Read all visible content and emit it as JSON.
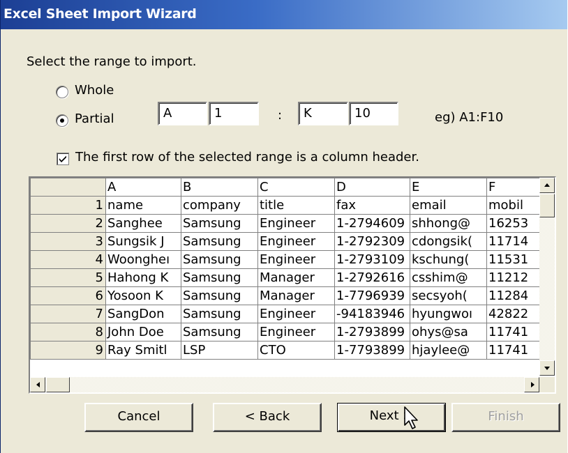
{
  "window": {
    "title": "Excel Sheet Import Wizard"
  },
  "instruction": "Select the range to import.",
  "range": {
    "whole_label": "Whole",
    "partial_label": "Partial",
    "selected": "partial",
    "start_col": "A",
    "start_row": "1",
    "separator": ":",
    "end_col": "K",
    "end_row": "10",
    "example": "eg) A1:F10"
  },
  "header_checkbox": {
    "label": "The first row of the selected range is a column header.",
    "checked": true
  },
  "grid": {
    "columns": [
      "A",
      "B",
      "C",
      "D",
      "E",
      "F"
    ],
    "rows": [
      {
        "num": "1",
        "cells": [
          "name",
          "company",
          "title",
          "fax",
          "email",
          "mobil"
        ]
      },
      {
        "num": "2",
        "cells": [
          "Sanghee",
          "Samsung",
          "Engineer",
          "1-2794609",
          "shhong@",
          "16253"
        ]
      },
      {
        "num": "3",
        "cells": [
          "Sungsik J",
          "Samsung",
          "Engineer",
          "1-2792309",
          "cdongsik(",
          "11714"
        ]
      },
      {
        "num": "4",
        "cells": [
          "Woongheı",
          "Samsung",
          "Engineer",
          "1-2793109",
          "kschung(",
          "11531"
        ]
      },
      {
        "num": "5",
        "cells": [
          "Hahong K",
          "Samsung",
          "Manager",
          "1-2792616",
          "csshim@",
          "11212"
        ]
      },
      {
        "num": "6",
        "cells": [
          "Yosoon K",
          "Samsung",
          "Manager",
          "1-7796939",
          "secsyoh(",
          "11284"
        ]
      },
      {
        "num": "7",
        "cells": [
          "SangDon",
          "Samsung",
          "Engineer",
          "-94183946",
          "hyungwoı",
          "42822"
        ]
      },
      {
        "num": "8",
        "cells": [
          "John Doe",
          "Samsung",
          "Engineer",
          "1-2793899",
          "ohys@sa",
          "11741"
        ]
      },
      {
        "num": "9",
        "cells": [
          "Ray Smitl",
          "LSP",
          "CTO",
          "1-7793899",
          "hjaylee@",
          "11741"
        ]
      }
    ]
  },
  "buttons": {
    "cancel": "Cancel",
    "back": "< Back",
    "next": "Next >",
    "finish": "Finish"
  }
}
